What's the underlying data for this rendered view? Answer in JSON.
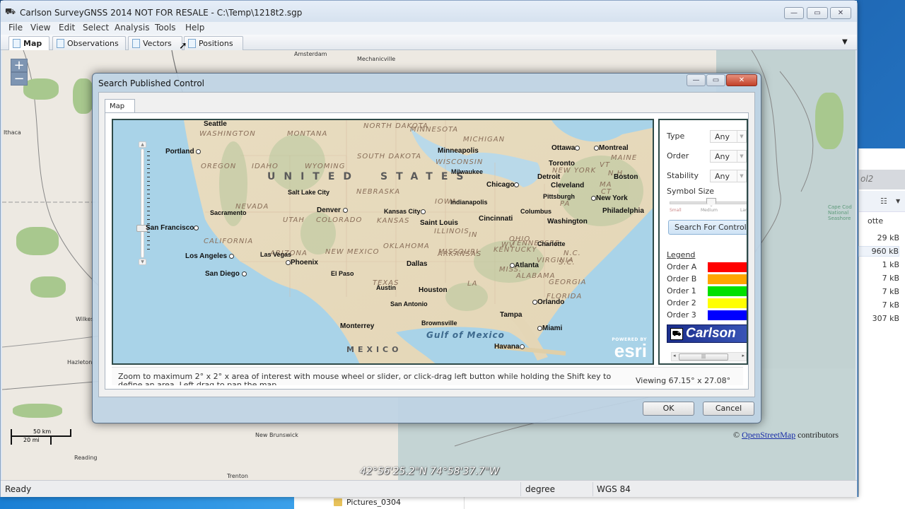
{
  "window": {
    "title": "Carlson SurveyGNSS 2014  NOT FOR RESALE - C:\\Temp\\1218t2.sgp",
    "minimize": "—",
    "maximize": "▭",
    "close": "✕"
  },
  "menu": [
    "File",
    "View",
    "Edit",
    "Select",
    "Analysis",
    "Tools",
    "Help"
  ],
  "tabs": [
    {
      "label": "Map",
      "active": true
    },
    {
      "label": "Observations",
      "active": false
    },
    {
      "label": "Vectors",
      "active": false
    },
    {
      "label": "Positions",
      "active": false
    }
  ],
  "tab_menu_icon": "▼",
  "background_map": {
    "zoom_in": "+",
    "zoom_out": "−",
    "labels": [
      "Amsterdam",
      "Mechanicville",
      "Ithaca",
      "Wilkes",
      "Hazleton",
      "Reading",
      "New Brunswick",
      "Trenton",
      "Cape Cod National Seashore"
    ],
    "scale_km": "50 km",
    "scale_mi": "20 mi",
    "coordinates": "42°56'25.2\"N 74°58'37.7\"W",
    "attribution_prefix": "©",
    "attribution_link": "OpenStreetMap",
    "attribution_suffix": "contributors"
  },
  "status_bar": {
    "status": "Ready",
    "units": "degree",
    "datum": "WGS 84"
  },
  "dialog": {
    "title": "Search Published Control",
    "tab": "Map",
    "map": {
      "countries": [
        "UNITED",
        "STATES",
        "MEXICO"
      ],
      "sea": "Gulf of Mexico",
      "states": [
        "WASHINGTON",
        "MONTANA",
        "NORTH DAKOTA",
        "MINNESOTA",
        "MICHIGAN",
        "OREGON",
        "IDAHO",
        "WYOMING",
        "SOUTH DAKOTA",
        "WISCONSIN",
        "NEVADA",
        "UTAH",
        "COLORADO",
        "NEBRASKA",
        "IOWA",
        "ILLINOIS",
        "IN",
        "OHIO",
        "KANSAS",
        "MISSOURI",
        "KENTUCKY",
        "CALIFORNIA",
        "ARIZONA",
        "NEW MEXICO",
        "OKLAHOMA",
        "ARKANSAS",
        "TENNESSEE",
        "TEXAS",
        "LA",
        "MISS.",
        "ALABAMA",
        "GEORGIA",
        "FLORIDA",
        "VIRGINIA",
        "WV",
        "PA",
        "NEW YORK",
        "MAINE",
        "VT",
        "N.H.",
        "MA",
        "CT",
        "N.C.",
        "S.C."
      ],
      "cities": [
        "Seattle",
        "Portland",
        "Sacramento",
        "San Francisco",
        "Los Angeles",
        "San Diego",
        "Las Vegas",
        "Salt Lake City",
        "Denver",
        "Phoenix",
        "El Paso",
        "Minneapolis",
        "Milwaukee",
        "Chicago",
        "Detroit",
        "Cleveland",
        "Toronto",
        "Ottawa",
        "Montreal",
        "Boston",
        "New York",
        "Philadelphia",
        "Pittsburgh",
        "Washington",
        "Columbus",
        "Cincinnati",
        "Indianapolis",
        "Kansas City",
        "Saint Louis",
        "Dallas",
        "Austin",
        "Houston",
        "San Antonio",
        "Brownsville",
        "Monterrey",
        "Atlanta",
        "Charlotte",
        "Tampa",
        "Orlando",
        "Miami",
        "Havana"
      ],
      "powered_by": "POWERED BY",
      "esri": "esri",
      "zoom_level_fraction": 0.7
    },
    "filters": [
      {
        "label": "Type",
        "value": "Any"
      },
      {
        "label": "Order",
        "value": "Any"
      },
      {
        "label": "Stability",
        "value": "Any"
      }
    ],
    "symbol_size": {
      "label": "Symbol Size",
      "ticks": [
        "Small",
        "Medium",
        "Large"
      ],
      "value": "Medium"
    },
    "search_button": "Search For Control",
    "legend": {
      "title": "Legend",
      "items": [
        {
          "label": "Order A",
          "color": "#ff0000"
        },
        {
          "label": "Order B",
          "color": "#ffa500"
        },
        {
          "label": "Order 1",
          "color": "#00e000"
        },
        {
          "label": "Order 2",
          "color": "#ffff00"
        },
        {
          "label": "Order 3",
          "color": "#0000ff"
        }
      ]
    },
    "logo": "Carlson",
    "hint": "Zoom to maximum 2° x 2° x area of interest with mouse wheel or slider, or click-drag left button while holding the Shift key to define an area. Left drag to pan the map.",
    "viewing": "Viewing 67.15° x 27.08°",
    "ok": "OK",
    "cancel": "Cancel"
  },
  "explorer": {
    "header": "ol2",
    "column": "otte",
    "sizes": [
      "29 kB",
      "960 kB",
      "1 kB",
      "7 kB",
      "7 kB",
      "7 kB",
      "307 kB"
    ],
    "folder": "Pictures_0304"
  }
}
